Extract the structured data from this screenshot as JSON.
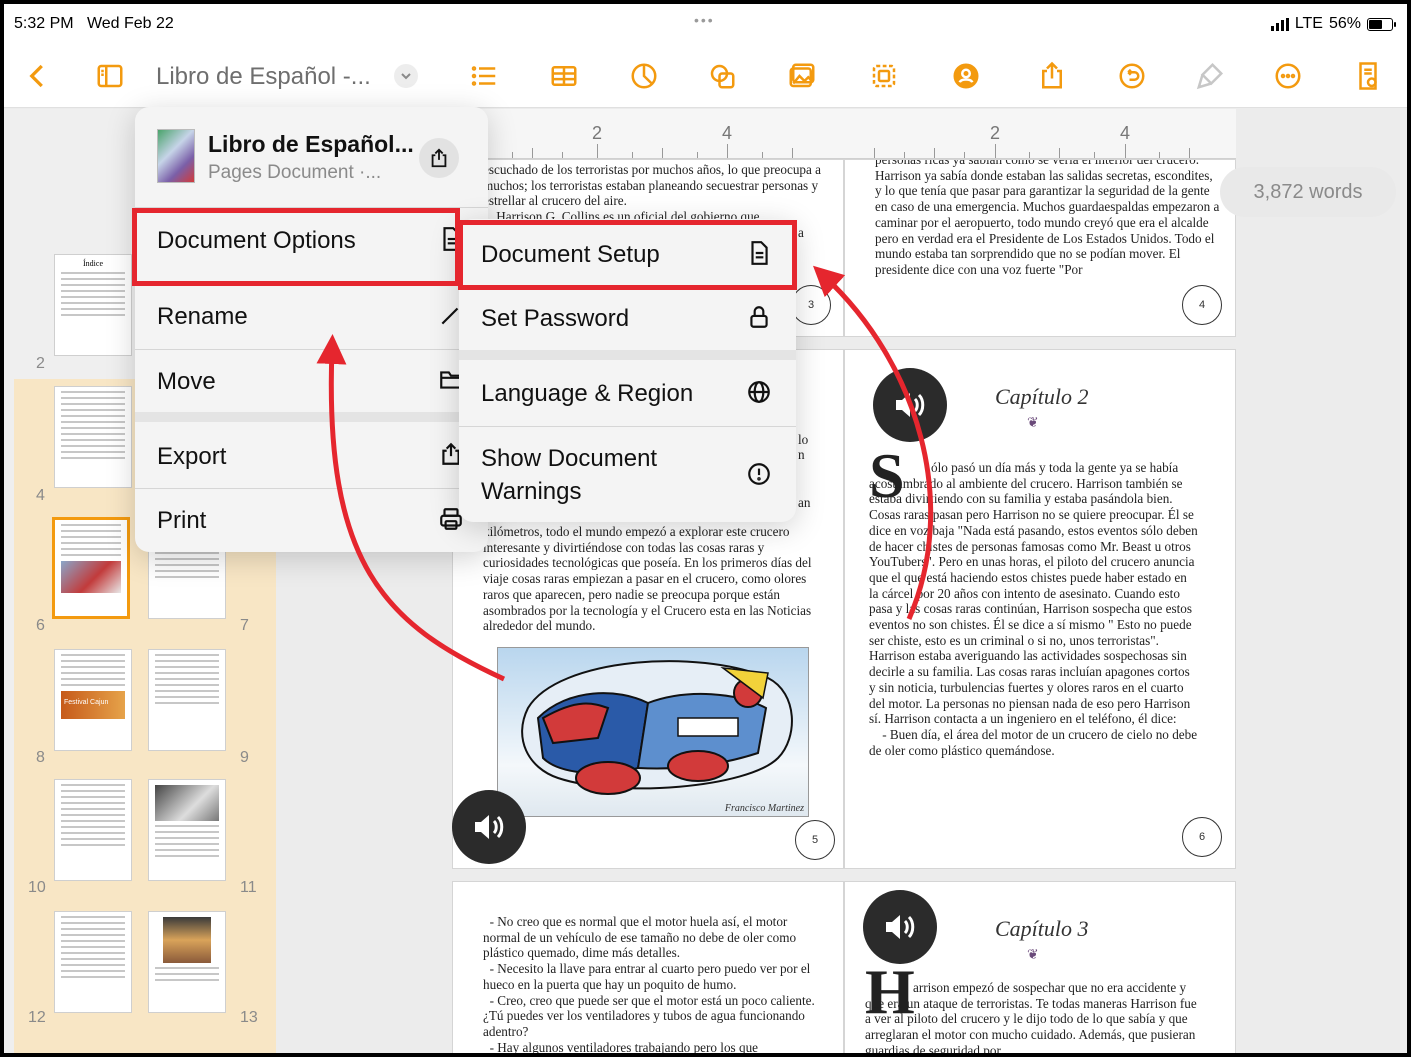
{
  "status_bar": {
    "time": "5:32 PM",
    "date": "Wed Feb 22",
    "network": "LTE",
    "battery": "56%"
  },
  "toolbar": {
    "document_title": "Libro de Español -...",
    "icons": [
      "back-chevron-icon",
      "sidebar-icon",
      "title-dropdown-icon",
      "list-icon",
      "table-icon",
      "chart-icon",
      "shape-icon",
      "media-icon",
      "arrange-icon",
      "collaborate-icon",
      "share-icon",
      "undo-icon",
      "format-brush-icon",
      "more-icon",
      "document-icon"
    ]
  },
  "word_count": "3,872 words",
  "document_menu": {
    "name": "Libro de Español...",
    "subtitle": "Pages Document ·...",
    "items": [
      {
        "label": "Document Options",
        "icon": "document-icon"
      },
      {
        "label": "Rename",
        "icon": "pencil-icon"
      },
      {
        "label": "Move",
        "icon": "folder-icon"
      },
      {
        "label": "Export",
        "icon": "share-icon"
      },
      {
        "label": "Print",
        "icon": "printer-icon"
      }
    ]
  },
  "submenu": {
    "items": [
      {
        "label": "Document Setup",
        "icon": "document-icon"
      },
      {
        "label": "Set Password",
        "icon": "lock-icon"
      },
      {
        "label": "Language & Region",
        "icon": "globe-icon"
      },
      {
        "label": "Show Document Warnings",
        "icon": "warning-icon"
      }
    ]
  },
  "ruler": {
    "marks_left": [
      "2",
      "4"
    ],
    "marks_right": [
      "2",
      "4"
    ]
  },
  "pages": {
    "p3_text": "escuchado de los terroristas por muchos años, lo que preocupa a muchos; los terroristas estaban planeando secuestrar personas y estrellar al crucero del aire.\n    Harrison G. Collins es un oficial del gobierno que",
    "p4_text": "personas ricas ya sabían como se vería el interior del crucero. Harrison ya sabía donde estaban las salidas secretas, escondites, y lo que tenía que pasar para garantizar la seguridad de la gente en caso de una emergencia. Muchos guardaespaldas empezaron a caminar por el aeropuerto, todo mundo creyó que era el alcalde pero en verdad era el Presidente de Los Estados Unidos. Todo el mundo estaba tan sorprendido que no se podían mover. El presidente dice con una voz fuerte \"Por",
    "p5_text": "kilómetros, todo el mundo empezó a explorar este crucero interesante y divirtiéndose con todas las cosas raras y curiosidades tecnológicas que poseía. En los primeros días del viaje cosas raras empiezan a pasar en el crucero, como olores raros que aparecen, pero nadie se preocupa porque están asombrados por la tecnología y el Crucero esta en las Noticias alrededor del mundo.",
    "p5_fragments": [
      "lo",
      "n",
      "an"
    ],
    "image_caption": "Francisco Martinez",
    "p6_chapter": "Capítulo 2",
    "p6_dropcap": "S",
    "p6_text": "ólo pasó un día más y toda la gente ya se había acostumbrado al ambiente del crucero. Harrison también se estaba divirtiendo con su familia y estaba pasándola bien. Cosas raras pasan pero Harrison no se quiere preocupar. Él se dice en voz baja \"Nada está pasando, estos eventos sólo deben de hacer chistes de personas famosas como Mr. Beast u otros YouTubers\". Pero en unas horas, el piloto del crucero anuncia que el que está haciendo estos chistes puede haber estado en la cárcel por 20 años con intento de asesinato. Cuando esto pasa y las cosas raras continúan, Harrison sospecha que estos eventos no son chistes. Él se dice a sí mismo \" Esto no puede ser chiste, esto es un criminal o si no, unos terroristas\". Harrison estaba averiguando las actividades sospechosas sin decirle a su familia. Las cosas raras incluían apagones cortos y sin noticia, turbulencias fuertes y olores raros en el cuarto del motor. La personas no piensan nada de eso pero Harrison sí. Harrison contacta a un ingeniero en el teléfono, él dice:\n    - Buen día, el área del motor de un crucero de cielo no debe de oler como plástico quemándose.",
    "p7_text": "  - No creo que es normal que el motor huela así, el motor normal de un vehículo de ese tamaño no debe de oler como plástico quemado, dime más detalles.\n  - Necesito la llave para entrar al cuarto pero puedo ver por el hueco en la puerta que hay un poquito de humo.\n  - Creo, creo que puede ser que el motor está un poco caliente. ¿Tú puedes ver los ventiladores y tubos de agua funcionando adentro?\n  - Hay algunos ventiladores trabajando pero los que",
    "p8_chapter": "Capítulo 3",
    "p8_dropcap": "H",
    "p8_text": "arrison empezó de sospechar que no era accidente y que era un ataque de terroristas. Te todas maneras Harrison fue a ver al piloto del crucero y le dijo todo de lo que sabía y que arreglaran el motor con mucho cuidado. Además, que pusieran guardias de seguridad por",
    "page_numbers": [
      "3",
      "4",
      "5",
      "6"
    ],
    "snippet_a": "a"
  },
  "sidebar": {
    "page_numbers": [
      "2",
      "4",
      "6",
      "7",
      "8",
      "9",
      "10",
      "11",
      "12",
      "13"
    ],
    "index_title": "Índice",
    "thumb_orange_label": "Festival Cajun"
  },
  "colors": {
    "accent": "#f39a0f",
    "annotation_red": "#e5262e"
  }
}
